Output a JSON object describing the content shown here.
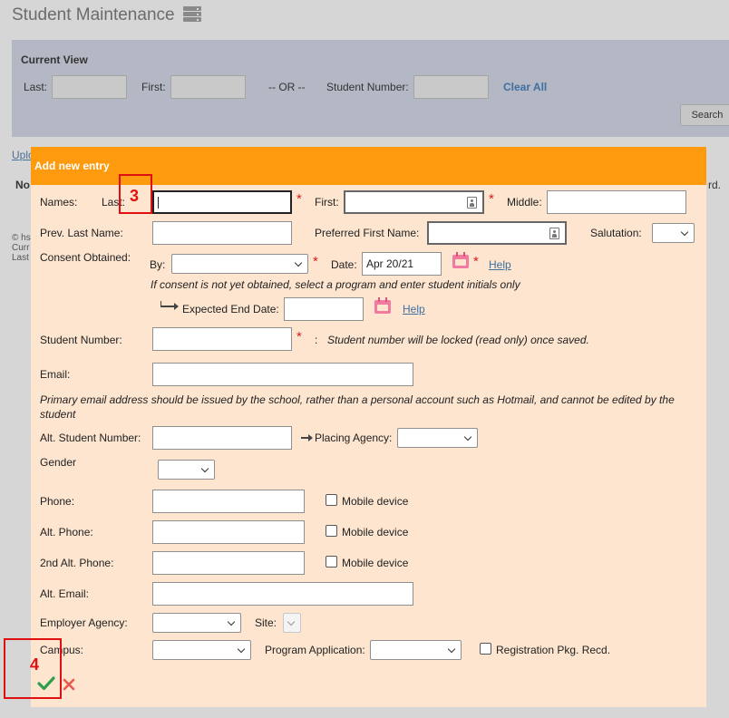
{
  "page": {
    "title": "Student Maintenance",
    "upload_link": "Uplo",
    "fragment_no": "No",
    "fragment_rd": "rd.",
    "footer_lines": [
      "© hs",
      "Curr",
      "Last"
    ]
  },
  "current_view": {
    "title": "Current View",
    "last_label": "Last:",
    "first_label": "First:",
    "or_label": "-- OR --",
    "student_number_label": "Student Number:",
    "clear_all": "Clear All",
    "search": "Search"
  },
  "dialog": {
    "title": "Add new entry",
    "names_label": "Names:",
    "last_label": "Last:",
    "first_label": "First:",
    "middle_label": "Middle:",
    "prev_last_label": "Prev. Last Name:",
    "preferred_first_label": "Preferred First Name:",
    "salutation_label": "Salutation:",
    "consent_label": "Consent Obtained:",
    "by_label": "By:",
    "date_label": "Date:",
    "date_value": "Apr 20/21",
    "help": "Help",
    "consent_note": "If consent is not yet obtained, select a program and enter student initials only",
    "expected_end_label": "Expected End Date:",
    "student_number_label": "Student Number:",
    "colon": ":",
    "student_number_note": "Student number will be locked (read only) once saved.",
    "email_label": "Email:",
    "email_note": "Primary email address should be issued by the school, rather than a personal account such as Hotmail, and cannot be edited by the student",
    "alt_student_number_label": "Alt. Student Number:",
    "placing_agency_label": "Placing Agency:",
    "gender_label": "Gender",
    "phone_label": "Phone:",
    "alt_phone_label": "Alt. Phone:",
    "second_alt_phone_label": "2nd Alt. Phone:",
    "mobile_device_label": "Mobile device",
    "alt_email_label": "Alt. Email:",
    "employer_agency_label": "Employer Agency:",
    "site_label": "Site:",
    "campus_label": "Campus:",
    "program_application_label": "Program Application:",
    "registration_pkg_label": "Registration Pkg. Recd.",
    "required_mark": "*"
  },
  "annotations": {
    "box3": "3",
    "box4": "4"
  },
  "colors": {
    "header": "#fd9a0e",
    "dialog_bg": "#fde5d0",
    "save_check": "#2e9e4b",
    "cancel_x": "#e8584c",
    "annotation": "#e01010"
  }
}
